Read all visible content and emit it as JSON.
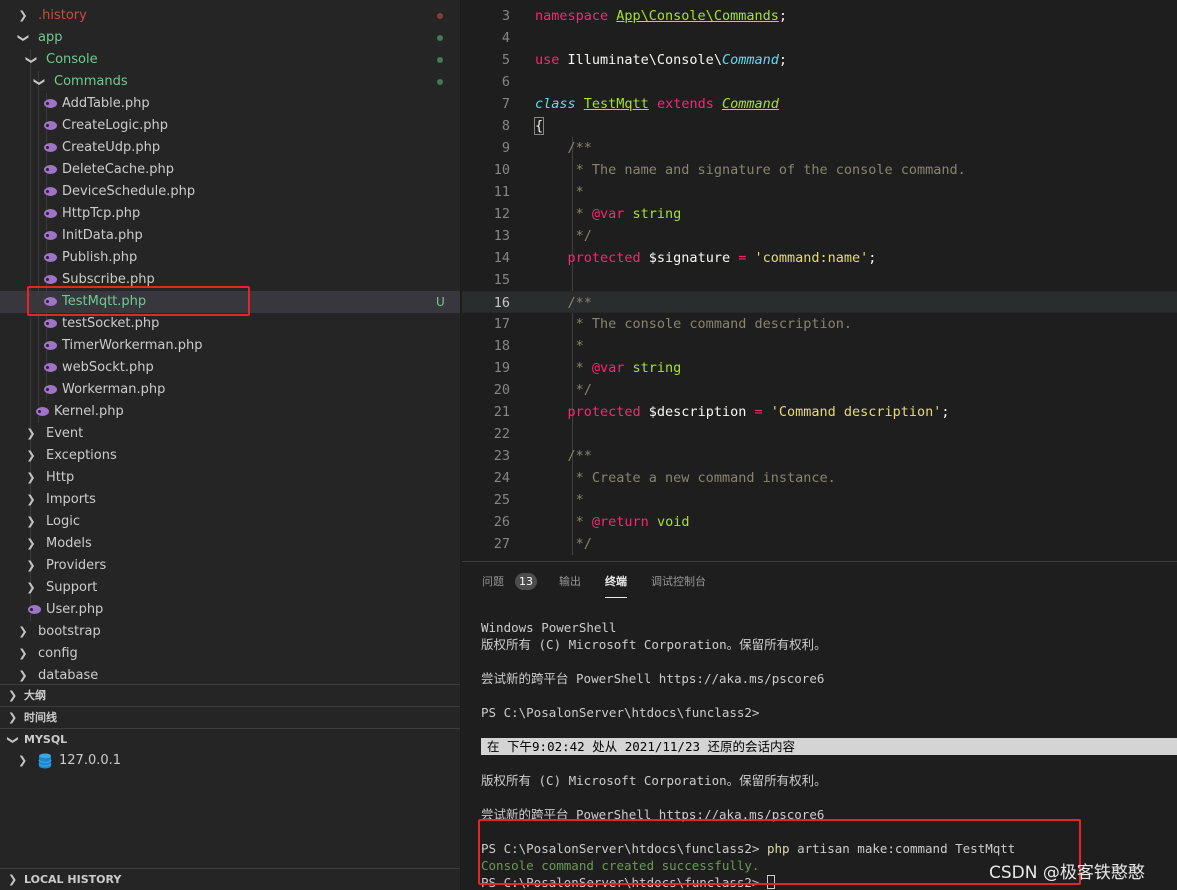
{
  "explorer": {
    "items": [
      {
        "label": ".history",
        "kind": "folder",
        "open": false,
        "status": "dot-red"
      },
      {
        "label": "app",
        "kind": "folder",
        "open": true,
        "status": "dot-green"
      },
      {
        "label": "Console",
        "kind": "folder",
        "open": true,
        "status": "dot-green"
      },
      {
        "label": "Commands",
        "kind": "folder",
        "open": true,
        "status": "dot-green"
      },
      {
        "label": "AddTable.php",
        "kind": "php"
      },
      {
        "label": "CreateLogic.php",
        "kind": "php"
      },
      {
        "label": "CreateUdp.php",
        "kind": "php"
      },
      {
        "label": "DeleteCache.php",
        "kind": "php"
      },
      {
        "label": "DeviceSchedule.php",
        "kind": "php"
      },
      {
        "label": "HttpTcp.php",
        "kind": "php"
      },
      {
        "label": "InitData.php",
        "kind": "php"
      },
      {
        "label": "Publish.php",
        "kind": "php"
      },
      {
        "label": "Subscribe.php",
        "kind": "php"
      },
      {
        "label": "TestMqtt.php",
        "kind": "php",
        "status_text": "U",
        "selected": true
      },
      {
        "label": "testSocket.php",
        "kind": "php"
      },
      {
        "label": "TimerWorkerman.php",
        "kind": "php"
      },
      {
        "label": "webSockt.php",
        "kind": "php"
      },
      {
        "label": "Workerman.php",
        "kind": "php"
      },
      {
        "label": "Kernel.php",
        "kind": "php"
      },
      {
        "label": "Event",
        "kind": "folder",
        "open": false
      },
      {
        "label": "Exceptions",
        "kind": "folder",
        "open": false
      },
      {
        "label": "Http",
        "kind": "folder",
        "open": false
      },
      {
        "label": "Imports",
        "kind": "folder",
        "open": false
      },
      {
        "label": "Logic",
        "kind": "folder",
        "open": false
      },
      {
        "label": "Models",
        "kind": "folder",
        "open": false
      },
      {
        "label": "Providers",
        "kind": "folder",
        "open": false
      },
      {
        "label": "Support",
        "kind": "folder",
        "open": false
      },
      {
        "label": "User.php",
        "kind": "php"
      },
      {
        "label": "bootstrap",
        "kind": "folder",
        "open": false
      },
      {
        "label": "config",
        "kind": "folder",
        "open": false
      },
      {
        "label": "database",
        "kind": "folder",
        "open": false
      }
    ],
    "sections": {
      "outline": "大纲",
      "timeline": "时间线",
      "mysql": "MYSQL",
      "mysql_host": "127.0.0.1",
      "local_history": "LOCAL HISTORY"
    }
  },
  "editor": {
    "active_line": "16",
    "lines": [
      {
        "n": "3",
        "tokens": [
          [
            "kw",
            "namespace "
          ],
          [
            "ns",
            "App\\Console\\Commands"
          ],
          [
            "plain",
            ";"
          ]
        ]
      },
      {
        "n": "4",
        "tokens": []
      },
      {
        "n": "5",
        "tokens": [
          [
            "kw",
            "use "
          ],
          [
            "plain",
            "Illuminate\\Console\\"
          ],
          [
            "typei",
            "Command"
          ],
          [
            "plain",
            ";"
          ]
        ]
      },
      {
        "n": "6",
        "tokens": []
      },
      {
        "n": "7",
        "tokens": [
          [
            "kwi",
            "class "
          ],
          [
            "cls",
            "TestMqtt"
          ],
          [
            "plain",
            " "
          ],
          [
            "kw",
            "extends "
          ],
          [
            "clsi",
            "Command"
          ]
        ]
      },
      {
        "n": "8",
        "tokens": [
          [
            "brace",
            "{"
          ]
        ]
      },
      {
        "n": "9",
        "tokens": [
          [
            "plain",
            "    "
          ],
          [
            "cmt",
            "/**"
          ]
        ]
      },
      {
        "n": "10",
        "tokens": [
          [
            "plain",
            "    "
          ],
          [
            "cmt",
            " * The name and signature of the console command."
          ]
        ]
      },
      {
        "n": "11",
        "tokens": [
          [
            "plain",
            "    "
          ],
          [
            "cmt",
            " *"
          ]
        ]
      },
      {
        "n": "12",
        "tokens": [
          [
            "plain",
            "    "
          ],
          [
            "cmt",
            " * "
          ],
          [
            "tag",
            "@var "
          ],
          [
            "tagv",
            "string"
          ]
        ]
      },
      {
        "n": "13",
        "tokens": [
          [
            "plain",
            "    "
          ],
          [
            "cmt",
            " */"
          ]
        ]
      },
      {
        "n": "14",
        "tokens": [
          [
            "plain",
            "    "
          ],
          [
            "kw",
            "protected "
          ],
          [
            "plain",
            "$signature "
          ],
          [
            "kw",
            "= "
          ],
          [
            "str",
            "'command:name'"
          ],
          [
            "plain",
            ";"
          ]
        ]
      },
      {
        "n": "15",
        "tokens": []
      },
      {
        "n": "16",
        "tokens": [
          [
            "plain",
            "    "
          ],
          [
            "cmt",
            "/**"
          ]
        ]
      },
      {
        "n": "17",
        "tokens": [
          [
            "plain",
            "    "
          ],
          [
            "cmt",
            " * The console command description."
          ]
        ]
      },
      {
        "n": "18",
        "tokens": [
          [
            "plain",
            "    "
          ],
          [
            "cmt",
            " *"
          ]
        ]
      },
      {
        "n": "19",
        "tokens": [
          [
            "plain",
            "    "
          ],
          [
            "cmt",
            " * "
          ],
          [
            "tag",
            "@var "
          ],
          [
            "tagv",
            "string"
          ]
        ]
      },
      {
        "n": "20",
        "tokens": [
          [
            "plain",
            "    "
          ],
          [
            "cmt",
            " */"
          ]
        ]
      },
      {
        "n": "21",
        "tokens": [
          [
            "plain",
            "    "
          ],
          [
            "kw",
            "protected "
          ],
          [
            "plain",
            "$description "
          ],
          [
            "kw",
            "= "
          ],
          [
            "str",
            "'Command description'"
          ],
          [
            "plain",
            ";"
          ]
        ]
      },
      {
        "n": "22",
        "tokens": []
      },
      {
        "n": "23",
        "tokens": [
          [
            "plain",
            "    "
          ],
          [
            "cmt",
            "/**"
          ]
        ]
      },
      {
        "n": "24",
        "tokens": [
          [
            "plain",
            "    "
          ],
          [
            "cmt",
            " * Create a new command instance."
          ]
        ]
      },
      {
        "n": "25",
        "tokens": [
          [
            "plain",
            "    "
          ],
          [
            "cmt",
            " *"
          ]
        ]
      },
      {
        "n": "26",
        "tokens": [
          [
            "plain",
            "    "
          ],
          [
            "cmt",
            " * "
          ],
          [
            "tag",
            "@return "
          ],
          [
            "tagv",
            "void"
          ]
        ]
      },
      {
        "n": "27",
        "tokens": [
          [
            "plain",
            "    "
          ],
          [
            "cmt",
            " */"
          ]
        ]
      }
    ]
  },
  "panel": {
    "tabs": {
      "problems": "问题",
      "problems_count": "13",
      "output": "输出",
      "terminal": "终端",
      "debug_console": "调试控制台"
    },
    "terminal": {
      "l1": "Windows PowerShell",
      "l2": "版权所有 (C) Microsoft Corporation。保留所有权利。",
      "l3": "尝试新的跨平台 PowerShell https://aka.ms/pscore6",
      "l4": "PS C:\\PosalonServer\\htdocs\\funclass2>",
      "restore": "在 下午9:02:42 处从 2021/11/23 还原的会话内容",
      "l5": "版权所有 (C) Microsoft Corporation。保留所有权利。",
      "l6": "尝试新的跨平台 PowerShell https://aka.ms/pscore6",
      "prompt": "PS C:\\PosalonServer\\htdocs\\funclass2> ",
      "cmd_name": "php",
      "cmd_args": " artisan make:command TestMqtt",
      "success": "Console command created successfully.",
      "prompt2": "PS C:\\PosalonServer\\htdocs\\funclass2> "
    },
    "watermark": "CSDN @极客铁憨憨"
  },
  "colors": {
    "selection_box": "#e3262a",
    "untracked": "#73c991",
    "php_icon": "#a074c4"
  }
}
